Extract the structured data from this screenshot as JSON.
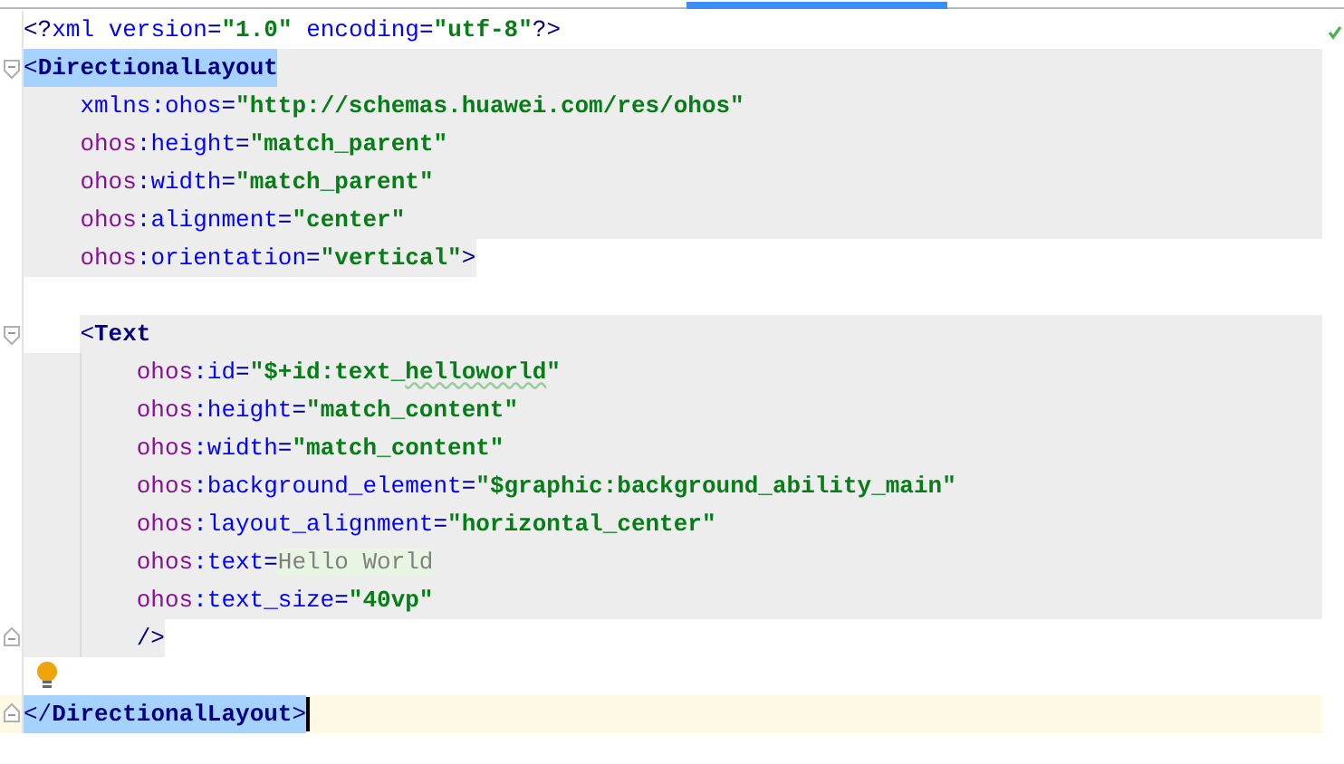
{
  "editor": {
    "tab_indicator": true,
    "status_ok": true,
    "lines": [
      {
        "kind": "code",
        "tokens": [
          {
            "t": "<?",
            "kind": "punct"
          },
          {
            "t": "xml",
            "kind": "keyword"
          },
          {
            "t": " version",
            "kind": "keyword"
          },
          {
            "t": "=",
            "kind": "punct"
          },
          {
            "t": "\"1.0\"",
            "kind": "value"
          },
          {
            "t": " encoding",
            "kind": "keyword"
          },
          {
            "t": "=",
            "kind": "punct"
          },
          {
            "t": "\"utf-8\"",
            "kind": "value"
          },
          {
            "t": "?>",
            "kind": "punct"
          }
        ],
        "highlighted": false
      },
      {
        "kind": "code",
        "tokens": [
          {
            "t": "<",
            "kind": "punct"
          },
          {
            "t": "DirectionalLayout",
            "kind": "tag"
          }
        ],
        "highlighted": true,
        "range_start": true,
        "selected": true,
        "fold_start": true,
        "children": [
          {
            "kind": "code",
            "tokens": [
              {
                "t": "xmlns:ohos",
                "kind": "keyword"
              },
              {
                "t": "=",
                "kind": "punct"
              },
              {
                "t": "\"http://schemas.huawei.com/res/ohos\"",
                "kind": "value"
              }
            ],
            "highlighted": true
          },
          {
            "kind": "code",
            "tokens": [
              {
                "t": "ohos",
                "kind": "ns"
              },
              {
                "t": ":height",
                "kind": "keyword"
              },
              {
                "t": "=",
                "kind": "punct"
              },
              {
                "t": "\"match_parent\"",
                "kind": "value"
              }
            ],
            "highlighted": true
          },
          {
            "kind": "code",
            "tokens": [
              {
                "t": "ohos",
                "kind": "ns"
              },
              {
                "t": ":width",
                "kind": "keyword"
              },
              {
                "t": "=",
                "kind": "punct"
              },
              {
                "t": "\"match_parent\"",
                "kind": "value"
              }
            ],
            "highlighted": true
          },
          {
            "kind": "code",
            "tokens": [
              {
                "t": "ohos",
                "kind": "ns"
              },
              {
                "t": ":alignment",
                "kind": "keyword"
              },
              {
                "t": "=",
                "kind": "punct"
              },
              {
                "t": "\"center\"",
                "kind": "value"
              }
            ],
            "highlighted": true
          },
          {
            "kind": "code",
            "tokens": [
              {
                "t": "ohos",
                "kind": "ns"
              },
              {
                "t": ":orientation",
                "kind": "keyword"
              },
              {
                "t": "=",
                "kind": "punct"
              },
              {
                "t": "\"vertical\"",
                "kind": "value"
              },
              {
                "t": ">",
                "kind": "punct"
              }
            ],
            "highlighted": true,
            "range_end": true
          },
          {
            "kind": "blank"
          },
          {
            "kind": "code",
            "tokens": [
              {
                "t": "<",
                "kind": "punct"
              },
              {
                "t": "Text",
                "kind": "tag"
              }
            ],
            "highlighted": true,
            "range_start": true,
            "fold_start": true,
            "children": [
              {
                "kind": "code",
                "tokens": [
                  {
                    "t": "ohos",
                    "kind": "ns"
                  },
                  {
                    "t": ":id",
                    "kind": "keyword"
                  },
                  {
                    "t": "=",
                    "kind": "punct"
                  },
                  {
                    "t": "\"$+id:text_",
                    "kind": "value"
                  },
                  {
                    "t": "helloworld",
                    "kind": "value",
                    "typo": true
                  },
                  {
                    "t": "\"",
                    "kind": "value"
                  }
                ],
                "highlighted": true
              },
              {
                "kind": "code",
                "tokens": [
                  {
                    "t": "ohos",
                    "kind": "ns"
                  },
                  {
                    "t": ":height",
                    "kind": "keyword"
                  },
                  {
                    "t": "=",
                    "kind": "punct"
                  },
                  {
                    "t": "\"match_content\"",
                    "kind": "value"
                  }
                ],
                "highlighted": true
              },
              {
                "kind": "code",
                "tokens": [
                  {
                    "t": "ohos",
                    "kind": "ns"
                  },
                  {
                    "t": ":width",
                    "kind": "keyword"
                  },
                  {
                    "t": "=",
                    "kind": "punct"
                  },
                  {
                    "t": "\"match_content\"",
                    "kind": "value"
                  }
                ],
                "highlighted": true
              },
              {
                "kind": "code",
                "tokens": [
                  {
                    "t": "ohos",
                    "kind": "ns"
                  },
                  {
                    "t": ":background_element",
                    "kind": "keyword"
                  },
                  {
                    "t": "=",
                    "kind": "punct"
                  },
                  {
                    "t": "\"$graphic:background_ability_main\"",
                    "kind": "value"
                  }
                ],
                "highlighted": true
              },
              {
                "kind": "code",
                "tokens": [
                  {
                    "t": "ohos",
                    "kind": "ns"
                  },
                  {
                    "t": ":layout_alignment",
                    "kind": "keyword"
                  },
                  {
                    "t": "=",
                    "kind": "punct"
                  },
                  {
                    "t": "\"horizontal_center\"",
                    "kind": "value"
                  }
                ],
                "highlighted": true
              },
              {
                "kind": "code",
                "tokens": [
                  {
                    "t": "ohos",
                    "kind": "ns"
                  },
                  {
                    "t": ":text",
                    "kind": "keyword"
                  },
                  {
                    "t": "=",
                    "kind": "punct"
                  },
                  {
                    "t": "Hello World",
                    "kind": "raw"
                  }
                ],
                "highlighted": true
              },
              {
                "kind": "code",
                "tokens": [
                  {
                    "t": "ohos",
                    "kind": "ns"
                  },
                  {
                    "t": ":text_size",
                    "kind": "keyword"
                  },
                  {
                    "t": "=",
                    "kind": "punct"
                  },
                  {
                    "t": "\"40vp\"",
                    "kind": "value"
                  }
                ],
                "highlighted": true
              },
              {
                "kind": "code",
                "tokens": [
                  {
                    "t": "/>",
                    "kind": "punct"
                  }
                ],
                "highlighted": true,
                "range_end": true,
                "fold_end": true
              }
            ]
          },
          {
            "kind": "blank",
            "bulb": true
          }
        ]
      },
      {
        "kind": "code",
        "tokens": [
          {
            "t": "</",
            "kind": "punct"
          },
          {
            "t": "DirectionalLayout",
            "kind": "tag"
          },
          {
            "t": ">",
            "kind": "punct"
          }
        ],
        "highlighted": false,
        "selected": true,
        "caret": true,
        "current": true,
        "fold_end": true
      }
    ]
  }
}
